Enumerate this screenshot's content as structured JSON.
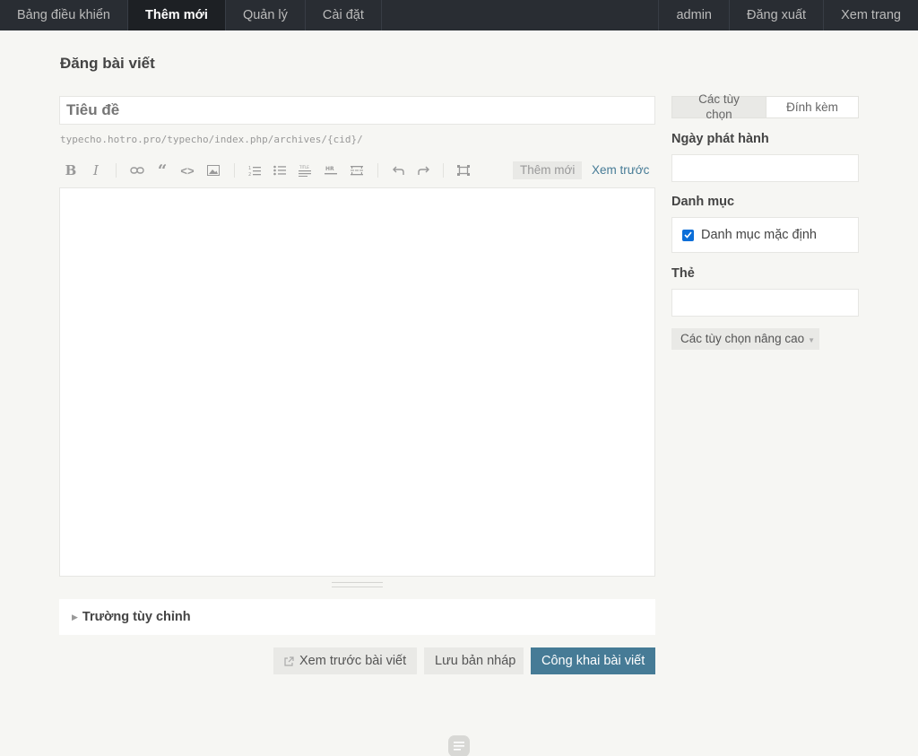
{
  "nav": {
    "left": [
      {
        "label": "Bảng điều khiển"
      },
      {
        "label": "Thêm mới"
      },
      {
        "label": "Quản lý"
      },
      {
        "label": "Cài đặt"
      }
    ],
    "right": [
      {
        "label": "admin"
      },
      {
        "label": "Đăng xuất"
      },
      {
        "label": "Xem trang"
      }
    ]
  },
  "page": {
    "title": "Đăng bài viết"
  },
  "post": {
    "title_placeholder": "Tiêu đề",
    "title_value": "",
    "url": "typecho.hotro.pro/typecho/index.php/archives/{cid}/"
  },
  "toolbar": {
    "write_tab": "Thêm mới",
    "preview_tab": "Xem trước",
    "icons": [
      "bold-icon",
      "italic-icon",
      "link-icon",
      "quote-icon",
      "code-icon",
      "image-icon",
      "ordered-list-icon",
      "bullet-list-icon",
      "heading-icon",
      "hr-icon",
      "more-icon",
      "undo-icon",
      "redo-icon",
      "fullscreen-icon"
    ]
  },
  "editor": {
    "content": ""
  },
  "custom_fields": {
    "label": "Trường tùy chỉnh"
  },
  "actions": {
    "preview": "Xem trước bài viết",
    "draft": "Lưu bản nháp",
    "publish": "Công khai bài viết"
  },
  "sidebar": {
    "tabs": [
      {
        "label": "Các tùy chọn"
      },
      {
        "label": "Đính kèm"
      }
    ],
    "date_label": "Ngày phát hành",
    "date_value": "",
    "category_label": "Danh mục",
    "categories": [
      {
        "label": "Danh mục mặc định",
        "checked": true
      }
    ],
    "tags_label": "Thẻ",
    "tags_value": "",
    "advanced": "Các tùy chọn nâng cao"
  },
  "colors": {
    "nav_bg": "#292d33",
    "page_bg": "#f6f6f3",
    "primary": "#467b96",
    "checkbox": "#0b6ed8"
  }
}
